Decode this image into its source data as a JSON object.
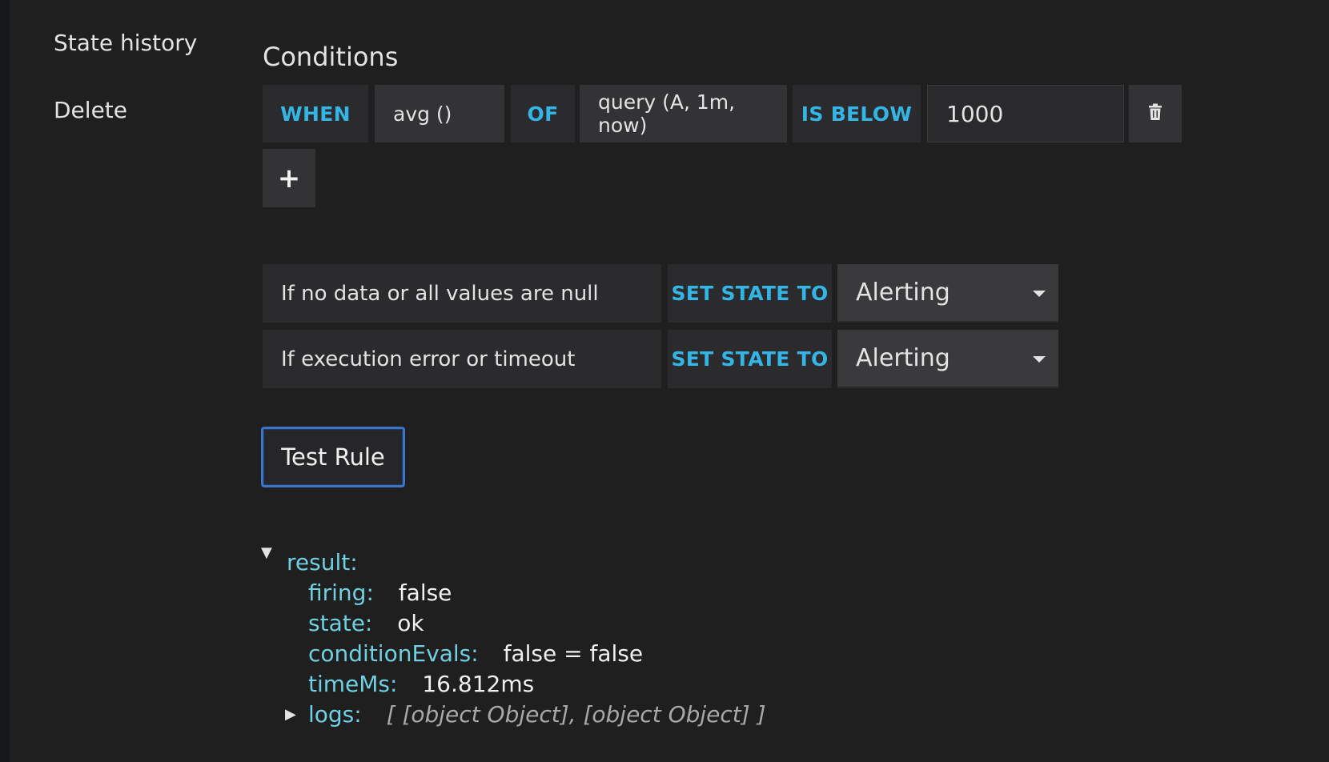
{
  "nav": {
    "state_history": "State history",
    "delete": "Delete"
  },
  "conditions": {
    "title": "Conditions",
    "when": "WHEN",
    "reducer": "avg ()",
    "of": "OF",
    "query": "query (A, 1m, now)",
    "evaluator": "IS BELOW",
    "threshold": "1000",
    "add_symbol": "+",
    "delete_icon": "trash-icon"
  },
  "state_rules": [
    {
      "label": "If no data or all values are null",
      "set_label": "SET STATE TO",
      "value": "Alerting"
    },
    {
      "label": "If execution error or timeout",
      "set_label": "SET STATE TO",
      "value": "Alerting"
    }
  ],
  "test_button": "Test Rule",
  "result": {
    "key": "result:",
    "firing": {
      "key": "firing:",
      "value": "false"
    },
    "state": {
      "key": "state:",
      "value": "ok"
    },
    "conditionEvals": {
      "key": "conditionEvals:",
      "value": "false = false"
    },
    "timeMs": {
      "key": "timeMs:",
      "value": "16.812ms"
    },
    "logs": {
      "key": "logs:",
      "value": "[ [object Object], [object Object] ]"
    }
  },
  "colors": {
    "keyword": "#33b5e5",
    "json_key": "#6ed0e0",
    "focus_border": "#3f74c4",
    "background": "#1f1f20"
  }
}
